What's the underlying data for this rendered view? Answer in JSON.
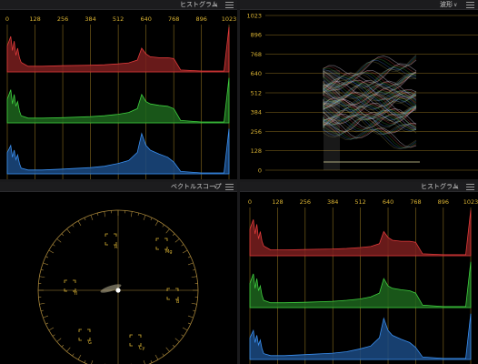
{
  "colors": {
    "grid": "#8a6d1e",
    "axis_text": "#d9b233",
    "red": "#e03a3a",
    "red_fill": "#7a1e1e",
    "green": "#3fcf3f",
    "green_fill": "#1d651d",
    "blue": "#3a8ff0",
    "blue_fill": "#1b4a82",
    "scope_line": "#a8863a"
  },
  "panels": {
    "histogram_top": {
      "title": "ヒストグラム",
      "scale_labels": [
        "0",
        "128",
        "256",
        "384",
        "512",
        "640",
        "768",
        "896",
        "1023"
      ]
    },
    "waveform": {
      "title": "波形",
      "scale_labels": [
        "1023",
        "896",
        "768",
        "640",
        "512",
        "384",
        "256",
        "128",
        "0"
      ]
    },
    "vectorscope": {
      "title": "ベクトルスコープ",
      "targets": [
        "R",
        "Mg",
        "B",
        "Cy",
        "G",
        "Yl"
      ]
    },
    "histogram_bottom": {
      "title": "ヒストグラム",
      "scale_labels": [
        "0",
        "128",
        "256",
        "384",
        "512",
        "640",
        "768",
        "896",
        "1023"
      ]
    }
  },
  "chart_data": [
    {
      "type": "area",
      "title": "",
      "x": [
        0,
        16,
        24,
        32,
        40,
        48,
        56,
        64,
        96,
        160,
        256,
        384,
        448,
        512,
        560,
        600,
        620,
        640,
        660,
        700,
        740,
        768,
        800,
        896,
        960,
        1000,
        1023
      ],
      "series": [
        {
          "values": [
            0.55,
            0.75,
            0.45,
            0.65,
            0.35,
            0.5,
            0.3,
            0.2,
            0.12,
            0.12,
            0.13,
            0.14,
            0.15,
            0.17,
            0.19,
            0.25,
            0.5,
            0.38,
            0.32,
            0.3,
            0.3,
            0.28,
            0.04,
            0.02,
            0.02,
            0.02,
            0.95
          ]
        },
        {
          "values": [
            0.5,
            0.7,
            0.4,
            0.6,
            0.35,
            0.45,
            0.25,
            0.15,
            0.1,
            0.1,
            0.11,
            0.13,
            0.15,
            0.18,
            0.22,
            0.3,
            0.6,
            0.45,
            0.4,
            0.37,
            0.35,
            0.3,
            0.05,
            0.02,
            0.02,
            0.02,
            0.95
          ]
        },
        {
          "values": [
            0.45,
            0.6,
            0.35,
            0.5,
            0.3,
            0.4,
            0.22,
            0.12,
            0.08,
            0.08,
            0.1,
            0.13,
            0.16,
            0.22,
            0.28,
            0.45,
            0.85,
            0.6,
            0.5,
            0.42,
            0.35,
            0.25,
            0.05,
            0.02,
            0.02,
            0.02,
            0.95
          ]
        }
      ],
      "ylim": [
        0,
        1
      ]
    },
    {
      "type": "area",
      "title": "",
      "x": [
        0,
        16,
        24,
        32,
        40,
        48,
        56,
        64,
        96,
        160,
        256,
        384,
        448,
        512,
        560,
        600,
        620,
        640,
        660,
        700,
        740,
        768,
        800,
        896,
        960,
        1000,
        1023
      ],
      "series": [
        {
          "values": [
            0.55,
            0.75,
            0.45,
            0.65,
            0.35,
            0.5,
            0.3,
            0.2,
            0.12,
            0.12,
            0.13,
            0.14,
            0.15,
            0.17,
            0.19,
            0.25,
            0.5,
            0.38,
            0.32,
            0.3,
            0.3,
            0.28,
            0.04,
            0.02,
            0.02,
            0.02,
            0.95
          ]
        },
        {
          "values": [
            0.5,
            0.7,
            0.4,
            0.6,
            0.35,
            0.45,
            0.25,
            0.15,
            0.1,
            0.1,
            0.11,
            0.13,
            0.15,
            0.18,
            0.22,
            0.3,
            0.6,
            0.45,
            0.4,
            0.37,
            0.35,
            0.3,
            0.05,
            0.02,
            0.02,
            0.02,
            0.95
          ]
        },
        {
          "values": [
            0.45,
            0.6,
            0.35,
            0.5,
            0.3,
            0.4,
            0.22,
            0.12,
            0.08,
            0.08,
            0.1,
            0.13,
            0.16,
            0.22,
            0.28,
            0.45,
            0.85,
            0.6,
            0.5,
            0.42,
            0.35,
            0.25,
            0.05,
            0.02,
            0.02,
            0.02,
            0.95
          ]
        }
      ],
      "ylim": [
        0,
        1
      ]
    }
  ]
}
